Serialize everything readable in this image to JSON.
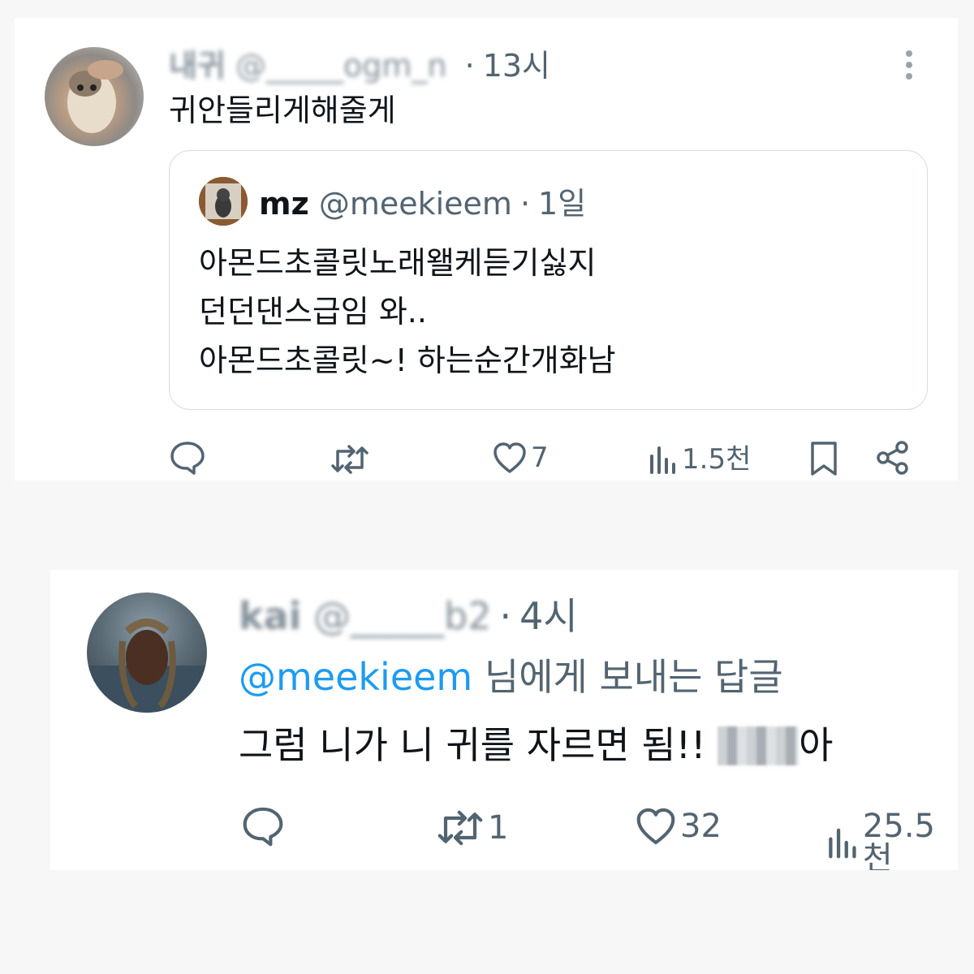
{
  "tweets": [
    {
      "author": {
        "name": "내귀",
        "handle": "@_____ogm_n",
        "time": "13시",
        "avatar": "hamster-photo"
      },
      "text": "귀안들리게해줄게",
      "quote": {
        "author": {
          "name": "mz",
          "handle": "@meekieem",
          "time": "1일",
          "avatar": "cat-photo"
        },
        "lines": [
          "아몬드초콜릿노래왤케듣기싫지",
          "던던댄스급임 와..",
          "아몬드초콜릿~! 하는순간개화남"
        ]
      },
      "actions": {
        "replies": "",
        "retweets": "",
        "likes": "7",
        "views": "1.5천"
      }
    },
    {
      "author": {
        "name": "kai",
        "handle": "@_____b2",
        "time": "4시",
        "avatar": "person-photo"
      },
      "reply_to": {
        "mention": "@meekieem",
        "suffix": " 님에게 보내는 답글"
      },
      "text": "그럼 니가 니 귀를 자르면 됨!! ",
      "text_tail": "아",
      "actions": {
        "replies": "",
        "retweets": "1",
        "likes": "32",
        "views": "25.5천"
      }
    }
  ],
  "icons": [
    "more-icon",
    "reply-icon",
    "retweet-icon",
    "like-icon",
    "views-icon",
    "bookmark-icon",
    "share-icon"
  ],
  "colors": {
    "text": "#0f1419",
    "muted": "#536471",
    "link": "#1d9bf0",
    "border": "#d5dbe0"
  }
}
